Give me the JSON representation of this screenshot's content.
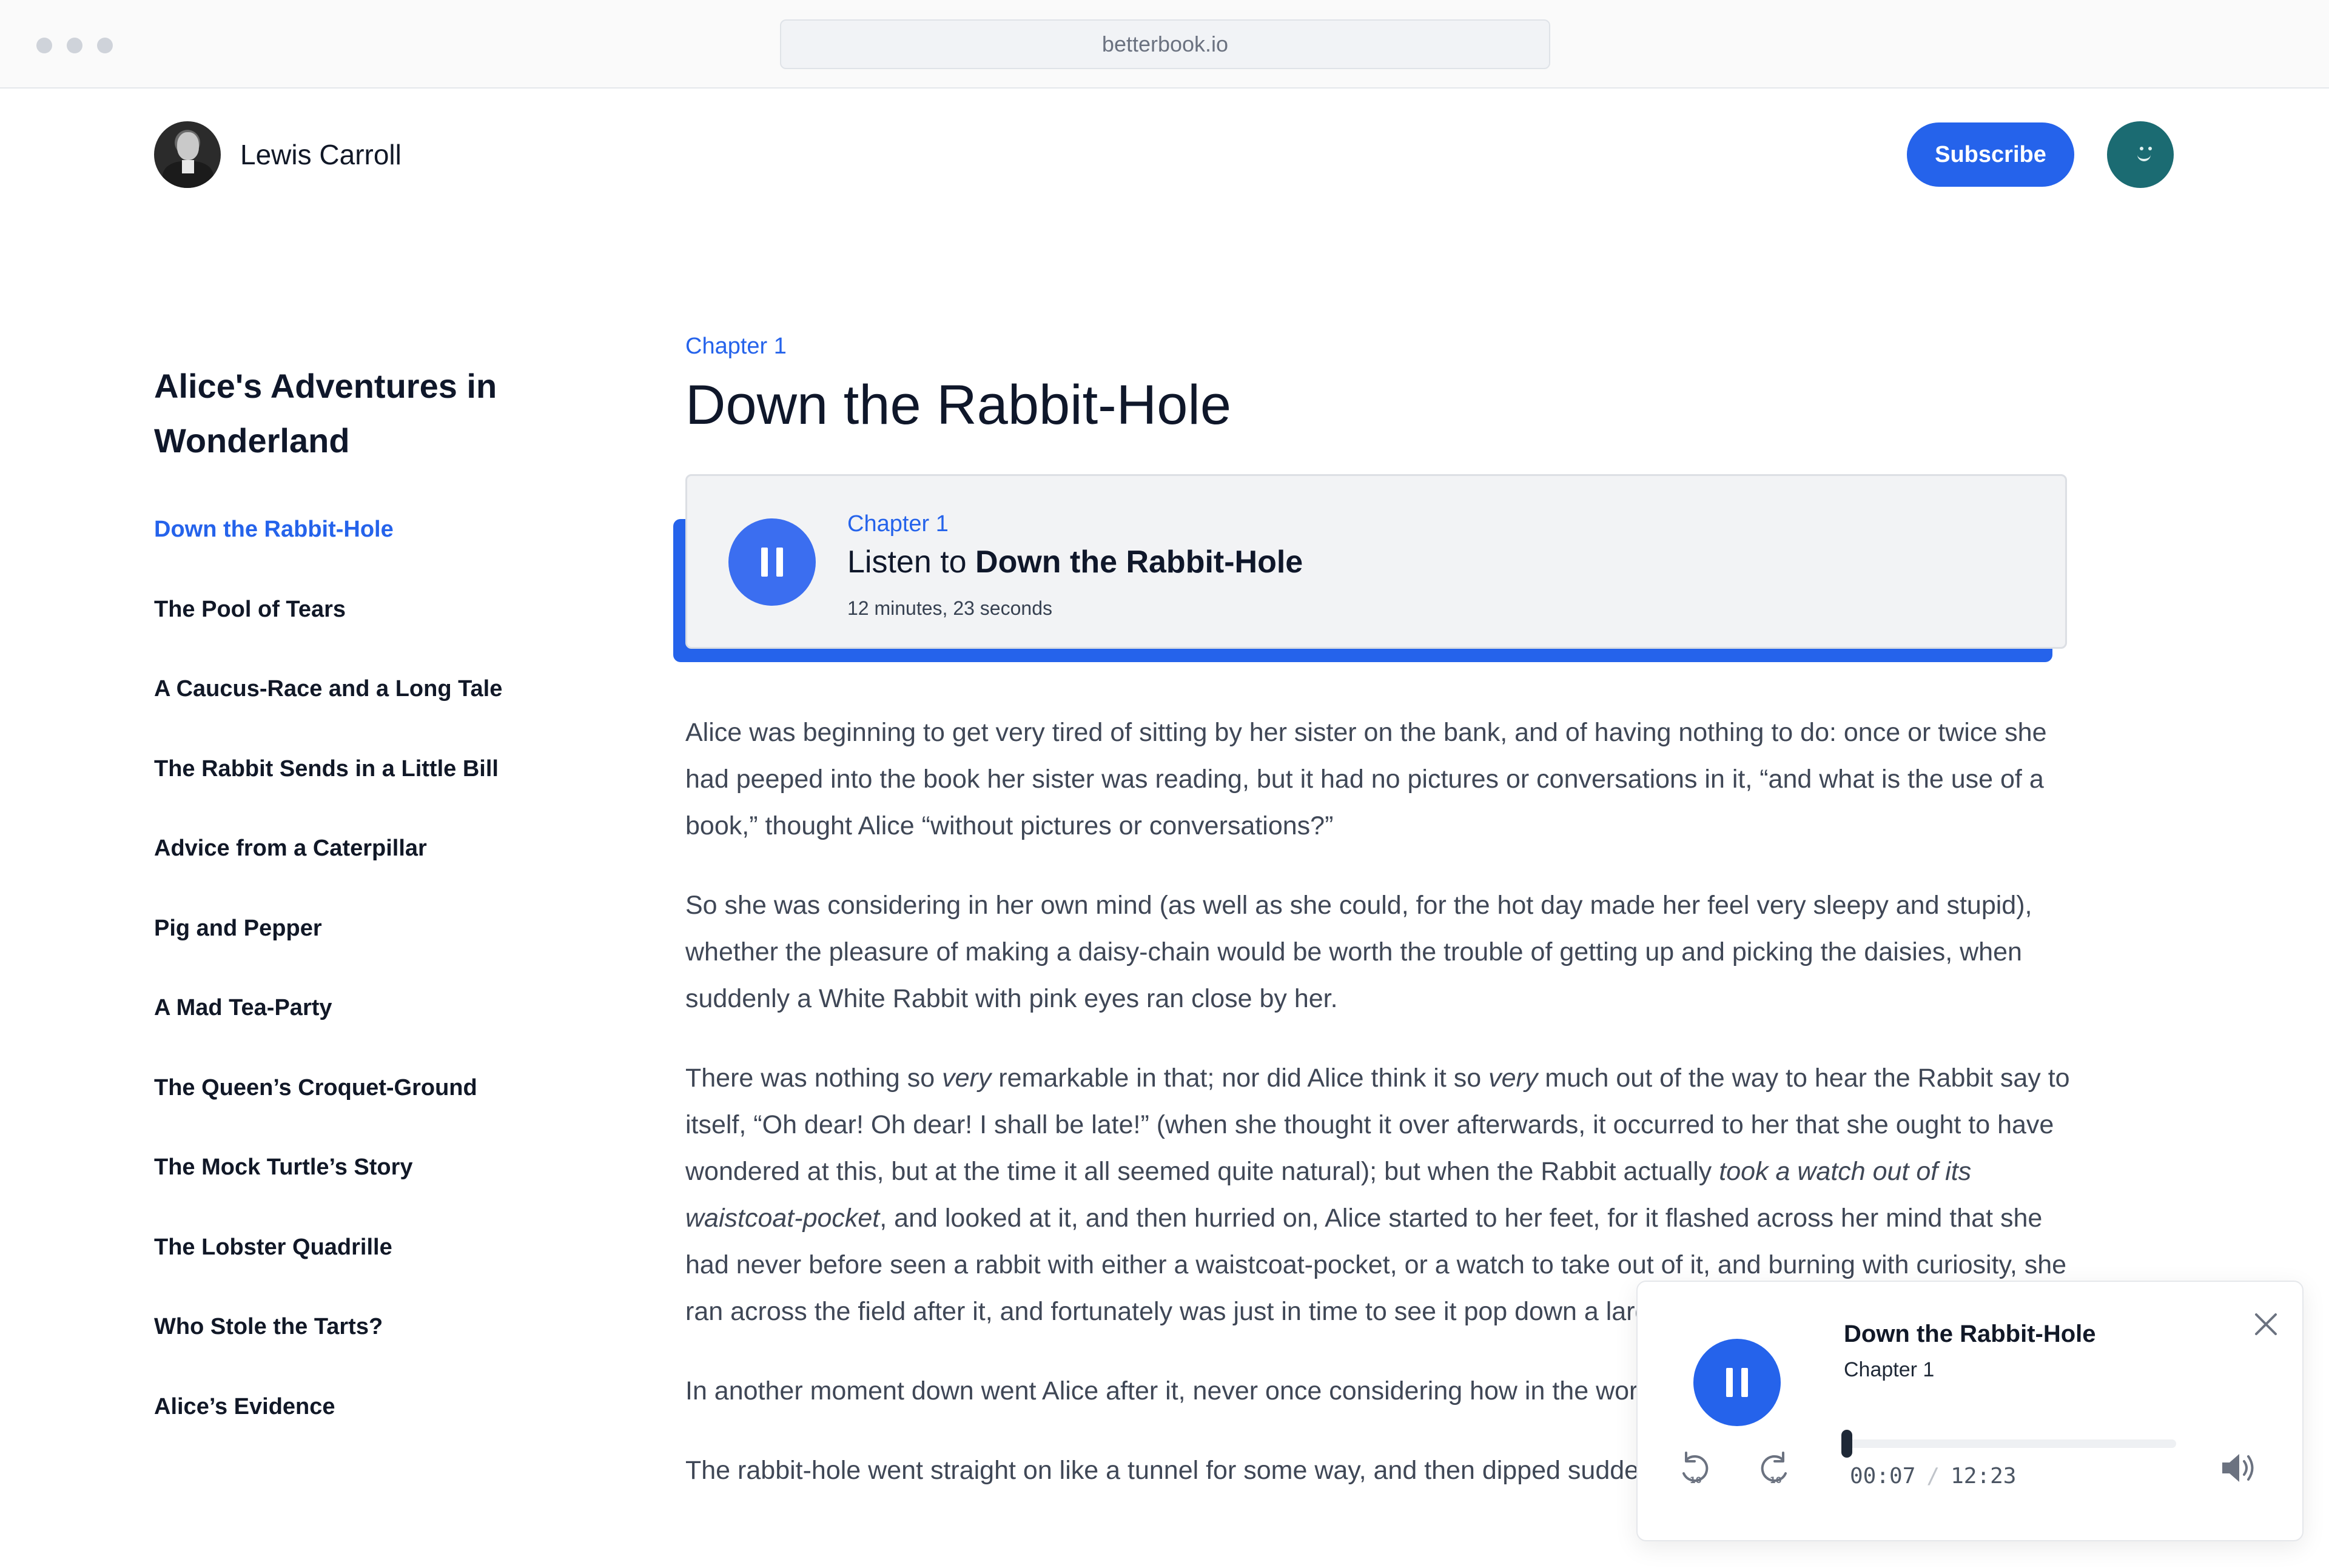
{
  "browser": {
    "url": "betterbook.io"
  },
  "header": {
    "author_name": "Lewis Carroll",
    "subscribe_label": "Subscribe"
  },
  "sidebar": {
    "book_title": "Alice's Adventures in Wonderland",
    "chapters": [
      "Down the Rabbit-Hole",
      "The Pool of Tears",
      "A Caucus-Race and a Long Tale",
      "The Rabbit Sends in a Little Bill",
      "Advice from a Caterpillar",
      "Pig and Pepper",
      "A Mad Tea-Party",
      "The Queen’s Croquet-Ground",
      "The Mock Turtle’s Story",
      "The Lobster Quadrille",
      "Who Stole the Tarts?",
      "Alice’s Evidence"
    ],
    "active_index": 0
  },
  "main": {
    "chapter_label": "Chapter 1",
    "chapter_title": "Down the Rabbit-Hole",
    "listen_card": {
      "chapter_label": "Chapter 1",
      "listen_prefix": "Listen to",
      "listen_title": "Down the Rabbit-Hole",
      "duration": "12 minutes, 23 seconds"
    },
    "paragraphs": [
      "Alice was beginning to get very tired of sitting by her sister on the bank, and of having nothing to do: once or twice she had peeped into the book her sister was reading, but it had no pictures or conversations in it, “and what is the use of a book,” thought Alice “without pictures or conversations?”",
      "So she was considering in her own mind (as well as she could, for the hot day made her feel very sleepy and stupid), whether the pleasure of making a daisy-chain would be worth the trouble of getting up and picking the daisies, when suddenly a White Rabbit with pink eyes ran close by her.",
      "There was nothing so <em>very</em> remarkable in that; nor did Alice think it so <em>very</em> much out of the way to hear the Rabbit say to itself, “Oh dear! Oh dear! I shall be late!” (when she thought it over afterwards, it occurred to her that she ought to have wondered at this, but at the time it all seemed quite natural); but when the Rabbit actually <em>took a watch out of its waistcoat-pocket</em>, and looked at it, and then hurried on, Alice started to her feet, for it flashed across her mind that she had never before seen a rabbit with either a waistcoat-pocket, or a watch to take out of it, and burning with curiosity, she ran across the field after it, and fortunately was just in time to see it pop down a large rabbit-hole under the hedge.",
      "In another moment down went Alice after it, never once considering how in the world she was to get out again.",
      "The rabbit-hole went straight on like a tunnel for some way, and then dipped suddenly down, so suddenly"
    ]
  },
  "player": {
    "title": "Down the Rabbit-Hole",
    "chapter": "Chapter 1",
    "current_time": "00:07",
    "separator": "/",
    "total_time": "12:23",
    "progress_fraction": 0.0094
  },
  "colors": {
    "accent": "#2563eb",
    "user_avatar": "#1b6b72"
  },
  "icons": {
    "pause": "pause-icon",
    "close": "close-icon",
    "rewind": "rewind-10-icon",
    "forward": "forward-10-icon",
    "volume": "volume-icon"
  }
}
